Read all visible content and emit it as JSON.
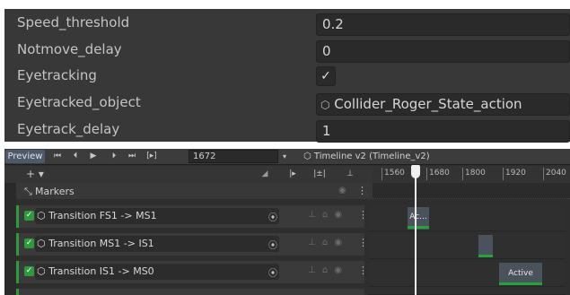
{
  "inspector": {
    "properties": [
      {
        "label": "Speed_threshold",
        "value": "0.2"
      },
      {
        "label": "Notmove_delay",
        "value": "0"
      },
      {
        "label": "Eyetracking",
        "value": "✓"
      },
      {
        "label": "Eyetracked_object",
        "value": "Collider_Roger_State_action",
        "icon": "cube-icon"
      },
      {
        "label": "Eyetrack_delay",
        "value": "1"
      }
    ]
  },
  "timeline": {
    "toolbar": {
      "preview": "Preview",
      "frame": "1672",
      "asset": "Timeline v2 (Timeline_v2)",
      "add": "+ ▾"
    },
    "ruler": [
      "1560",
      "1680",
      "1800",
      "1920",
      "2040"
    ],
    "markers_label": "Markers",
    "tracks": [
      {
        "label": "Transition FS1 -> MS1",
        "clip": "Ac..."
      },
      {
        "label": "Transition MS1 -> IS1",
        "clip": ""
      },
      {
        "label": "Transition IS1 -> MS0",
        "clip": "Active"
      }
    ]
  },
  "colors": {
    "panel": "#383838",
    "track_accent": "#2f9a3a",
    "clip": "#4a525c",
    "active_bar": "#1fa538"
  }
}
